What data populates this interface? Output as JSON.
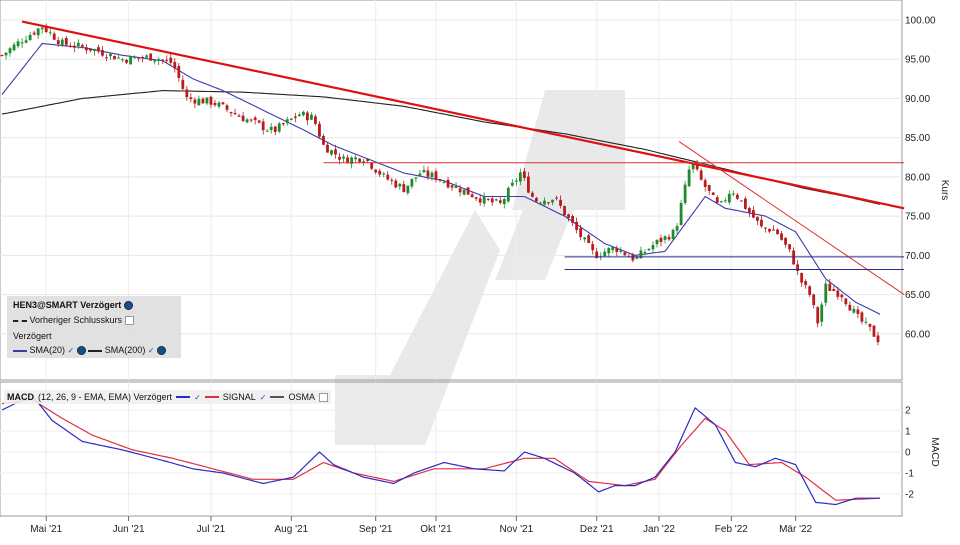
{
  "chart_data": [
    {
      "type": "candlestick",
      "name_label": "HEN3@SMART Verzögert",
      "prev_close_label": "Vorheriger Schlusskurs",
      "delay_label": "Verzögert",
      "ylabel": "Kurs",
      "ylim": [
        55,
        100
      ],
      "yticks": [
        "100.00",
        "95.00",
        "90.00",
        "85.00",
        "80.00",
        "75.00",
        "70.00",
        "65.00",
        "60.00"
      ],
      "x_months": [
        "Mai '21",
        "Jun '21",
        "Jul '21",
        "Aug '21",
        "Sep '21",
        "Okt '21",
        "Nov '21",
        "Dez '21",
        "Jan '22",
        "Feb '22",
        "Mär '22"
      ],
      "series": [
        {
          "name": "SMA(20)",
          "color": "#3b3bb0"
        },
        {
          "name": "SMA(200)",
          "color": "#222222"
        }
      ],
      "close_anchors": [
        [
          0,
          95.5
        ],
        [
          10,
          97.5
        ],
        [
          20,
          99.2
        ],
        [
          30,
          97.0
        ],
        [
          45,
          96.3
        ],
        [
          60,
          95.0
        ],
        [
          75,
          95.3
        ],
        [
          85,
          94.5
        ],
        [
          92,
          90.0
        ],
        [
          105,
          89.5
        ],
        [
          120,
          87.5
        ],
        [
          135,
          85.8
        ],
        [
          148,
          88.0
        ],
        [
          155,
          87.5
        ],
        [
          160,
          84.0
        ],
        [
          170,
          82.2
        ],
        [
          180,
          82.5
        ],
        [
          190,
          80.0
        ],
        [
          200,
          78.5
        ],
        [
          208,
          80.5
        ],
        [
          216,
          80.0
        ],
        [
          225,
          78.8
        ],
        [
          240,
          77.0
        ],
        [
          248,
          76.5
        ],
        [
          258,
          80.5
        ],
        [
          265,
          77.0
        ],
        [
          275,
          77.3
        ],
        [
          285,
          73.5
        ],
        [
          295,
          70.0
        ],
        [
          305,
          71.0
        ],
        [
          315,
          69.5
        ],
        [
          325,
          71.5
        ],
        [
          335,
          73.0
        ],
        [
          343,
          82.0
        ],
        [
          348,
          79.5
        ],
        [
          357,
          76.0
        ],
        [
          363,
          78.5
        ],
        [
          372,
          75.5
        ],
        [
          378,
          73.5
        ],
        [
          385,
          73.2
        ],
        [
          393,
          70.0
        ],
        [
          397,
          67.0
        ],
        [
          402,
          65.0
        ],
        [
          406,
          61.5
        ],
        [
          410,
          66.0
        ],
        [
          418,
          65.0
        ],
        [
          426,
          62.0
        ],
        [
          432,
          60.5
        ],
        [
          437,
          59.0
        ]
      ],
      "sma20_anchors": [
        [
          0,
          90.5
        ],
        [
          20,
          97.0
        ],
        [
          40,
          96.5
        ],
        [
          60,
          95.5
        ],
        [
          80,
          94.8
        ],
        [
          95,
          92.5
        ],
        [
          110,
          91.0
        ],
        [
          130,
          88.5
        ],
        [
          150,
          86.0
        ],
        [
          165,
          84.0
        ],
        [
          185,
          82.0
        ],
        [
          200,
          80.5
        ],
        [
          220,
          79.5
        ],
        [
          240,
          77.5
        ],
        [
          260,
          77.5
        ],
        [
          280,
          75.0
        ],
        [
          300,
          71.5
        ],
        [
          315,
          70.0
        ],
        [
          330,
          70.5
        ],
        [
          340,
          74.0
        ],
        [
          350,
          77.5
        ],
        [
          360,
          76.0
        ],
        [
          380,
          75.0
        ],
        [
          395,
          73.0
        ],
        [
          410,
          67.0
        ],
        [
          425,
          64.0
        ],
        [
          437,
          62.5
        ]
      ],
      "sma200_anchors": [
        [
          0,
          88.0
        ],
        [
          40,
          90.0
        ],
        [
          80,
          91.0
        ],
        [
          120,
          90.8
        ],
        [
          160,
          90.2
        ],
        [
          200,
          89.0
        ],
        [
          240,
          87.0
        ],
        [
          280,
          85.5
        ],
        [
          320,
          83.5
        ],
        [
          360,
          81.0
        ],
        [
          400,
          78.5
        ],
        [
          420,
          77.5
        ],
        [
          437,
          76.5
        ]
      ],
      "trendlines": [
        {
          "from": [
            10,
            99.8
          ],
          "to": [
            450,
            76.0
          ],
          "color": "#e01010",
          "width": 2.2
        },
        {
          "from": [
            337,
            84.5
          ],
          "to": [
            450,
            65.0
          ],
          "color": "#e03030",
          "width": 1.0
        },
        {
          "from": [
            160,
            81.8
          ],
          "to": [
            450,
            81.8
          ],
          "color": "#e03030",
          "width": 1.0
        },
        {
          "from": [
            280,
            69.8
          ],
          "to": [
            450,
            69.8
          ],
          "color": "#2a2a90",
          "width": 1.0
        },
        {
          "from": [
            280,
            68.2
          ],
          "to": [
            450,
            68.2
          ],
          "color": "#2a2a90",
          "width": 1.0
        }
      ]
    },
    {
      "type": "line",
      "name_label": "MACD",
      "params_label": "(12, 26, 9 - EMA, EMA) Verzögert",
      "ylabel": "MACD",
      "ylim": [
        -3,
        3
      ],
      "yticks": [
        "2",
        "1",
        "0",
        "-1",
        "-2"
      ],
      "series": [
        {
          "name": "MACD",
          "color": "#2a2ac8"
        },
        {
          "name": "SIGNAL",
          "color": "#e03040"
        },
        {
          "name": "OSMA",
          "color": "#555555"
        }
      ],
      "macd_anchors": [
        [
          0,
          2.0
        ],
        [
          15,
          2.7
        ],
        [
          25,
          1.5
        ],
        [
          40,
          0.5
        ],
        [
          60,
          0.1
        ],
        [
          80,
          -0.4
        ],
        [
          95,
          -0.8
        ],
        [
          110,
          -1.0
        ],
        [
          130,
          -1.5
        ],
        [
          145,
          -1.2
        ],
        [
          158,
          0.0
        ],
        [
          165,
          -0.6
        ],
        [
          180,
          -1.2
        ],
        [
          195,
          -1.5
        ],
        [
          205,
          -1.0
        ],
        [
          220,
          -0.5
        ],
        [
          235,
          -0.8
        ],
        [
          250,
          -0.9
        ],
        [
          260,
          0.0
        ],
        [
          270,
          -0.3
        ],
        [
          285,
          -1.0
        ],
        [
          297,
          -1.9
        ],
        [
          305,
          -1.6
        ],
        [
          315,
          -1.6
        ],
        [
          325,
          -1.2
        ],
        [
          335,
          0.0
        ],
        [
          345,
          2.1
        ],
        [
          355,
          1.3
        ],
        [
          365,
          -0.5
        ],
        [
          375,
          -0.7
        ],
        [
          385,
          -0.3
        ],
        [
          395,
          -0.6
        ],
        [
          405,
          -2.4
        ],
        [
          415,
          -2.5
        ],
        [
          425,
          -2.2
        ],
        [
          437,
          -2.2
        ]
      ],
      "signal_anchors": [
        [
          0,
          2.3
        ],
        [
          15,
          2.5
        ],
        [
          30,
          1.6
        ],
        [
          45,
          0.8
        ],
        [
          65,
          0.1
        ],
        [
          85,
          -0.3
        ],
        [
          105,
          -0.8
        ],
        [
          125,
          -1.3
        ],
        [
          145,
          -1.3
        ],
        [
          160,
          -0.5
        ],
        [
          175,
          -1.0
        ],
        [
          195,
          -1.4
        ],
        [
          215,
          -0.8
        ],
        [
          240,
          -0.8
        ],
        [
          260,
          -0.3
        ],
        [
          275,
          -0.3
        ],
        [
          292,
          -1.4
        ],
        [
          310,
          -1.6
        ],
        [
          325,
          -1.3
        ],
        [
          338,
          0.3
        ],
        [
          350,
          1.6
        ],
        [
          360,
          1.0
        ],
        [
          372,
          -0.6
        ],
        [
          388,
          -0.5
        ],
        [
          400,
          -1.2
        ],
        [
          415,
          -2.3
        ],
        [
          437,
          -2.2
        ]
      ]
    }
  ]
}
